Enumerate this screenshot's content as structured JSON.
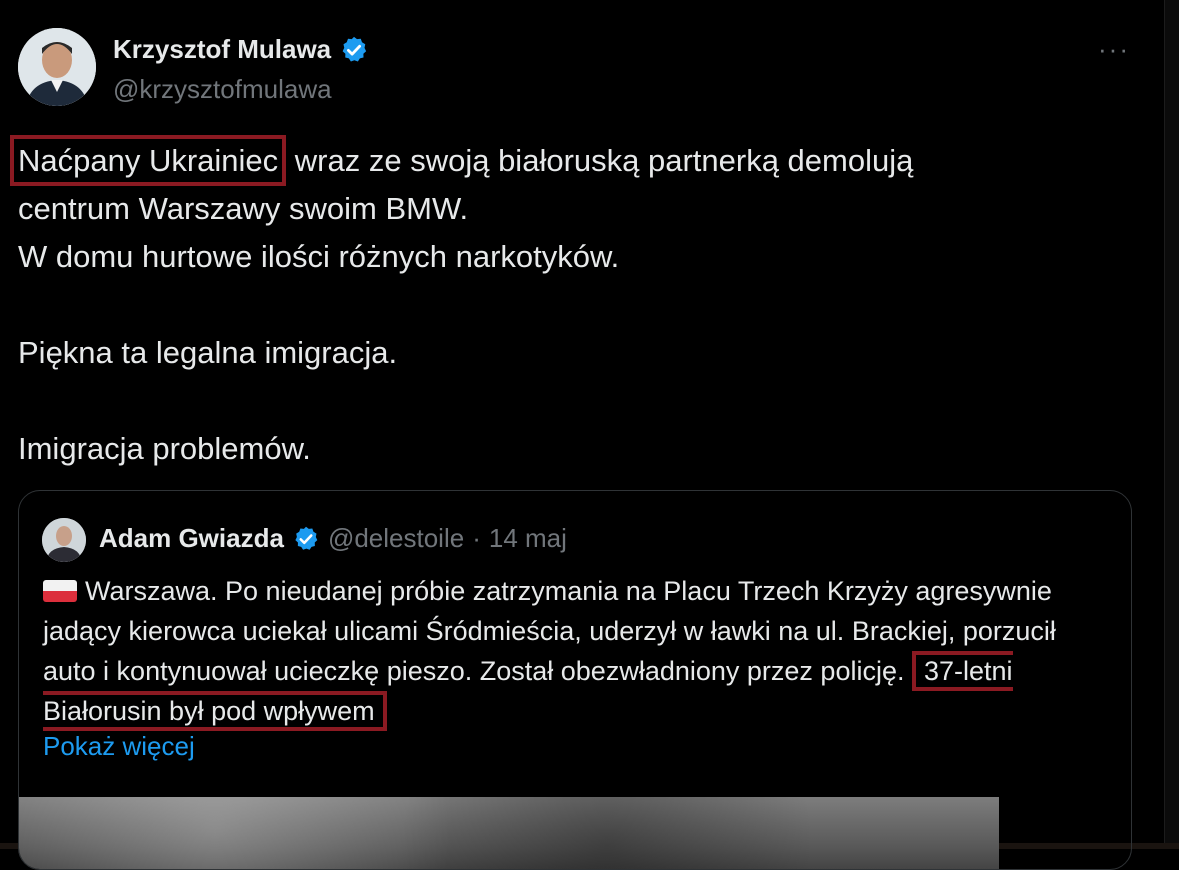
{
  "author": {
    "name": "Krzysztof Mulawa",
    "handle": "@krzysztofmulawa",
    "verified": true
  },
  "menu": {
    "more_label": "···"
  },
  "tweet": {
    "highlight": "Naćpany Ukrainiec",
    "line1_rest": " wraz ze swoją białoruską partnerką demolują",
    "line2": "centrum Warszawy swoim BMW.",
    "line3": "W domu hurtowe ilości różnych narkotyków.",
    "line4": "Piękna ta legalna imigracja.",
    "line5": "Imigracja problemów."
  },
  "quote": {
    "name": "Adam Gwiazda",
    "handle": "@delestoile",
    "separator": "·",
    "date": "14 maj",
    "text_before": "Warszawa. Po nieudanej próbie zatrzymania na Placu Trzech Krzyży agresywnie jadący kierowca uciekał ulicami Śródmieścia, uderzył w ławki na ul. Brackiej, porzucił auto i kontynuował ucieczkę pieszo. Został obezwładniony przez policję.",
    "text_highlight": "37-letni Białorusin był pod wpływem",
    "show_more": "Pokaż więcej"
  },
  "colors": {
    "background": "#000000",
    "verified_blue": "#1d9bf0",
    "highlight_border": "#8b1a22",
    "muted": "#71767b",
    "link": "#1d9bf0"
  },
  "icons": [
    "verified-badge-icon",
    "more-icon",
    "poland-flag-icon"
  ]
}
